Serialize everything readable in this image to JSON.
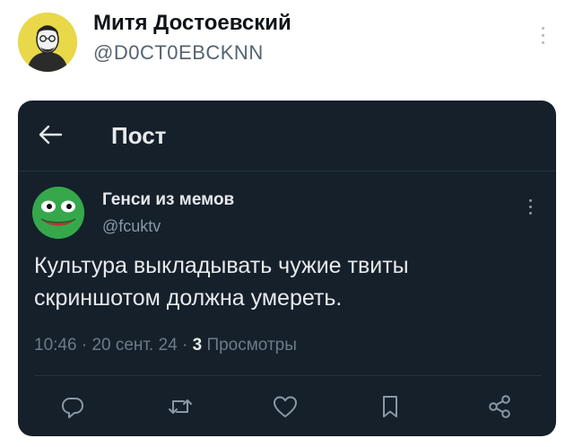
{
  "outer_tweet": {
    "author_name": "Митя Достоевский",
    "author_handle": "@D0CT0EBCKNN",
    "avatar": "avatar-portrait-icon",
    "more": "more-vertical-icon"
  },
  "screenshot": {
    "header": {
      "back_icon": "arrow-left-icon",
      "title": "Пост"
    },
    "post": {
      "author_name": "Генси из мемов",
      "author_handle": "@fcuktv",
      "avatar": "frog-avatar-icon",
      "text_lines": [
        "Культура выкладывать чужие твиты",
        "скриншотом должна умереть."
      ],
      "time": "10:46",
      "date": "20 сент. 24",
      "separator": "·",
      "views_count": "3",
      "views_label": "Просмотры"
    },
    "actions": [
      {
        "icon": "reply-icon"
      },
      {
        "icon": "retweet-icon"
      },
      {
        "icon": "like-icon"
      },
      {
        "icon": "bookmark-icon"
      },
      {
        "icon": "share-icon"
      }
    ]
  },
  "colors": {
    "dark_background": "#15202b",
    "primary_text_dark": "#e7e9ea",
    "secondary_text_dark": "#8b98a5",
    "primary_text_light": "#0f1419",
    "secondary_text_light": "#536471"
  }
}
